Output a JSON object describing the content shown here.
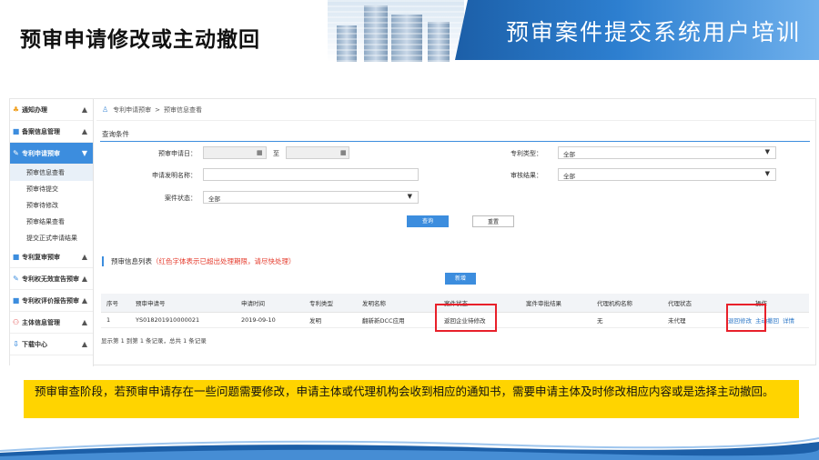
{
  "slide": {
    "title": "预审申请修改或主动撤回",
    "banner": "预审案件提交系统用户培训",
    "note": "预审审查阶段，若预审申请存在一些问题需要修改，申请主体或代理机构会收到相应的通知书，需要申请主体及时修改相应内容或是选择主动撤回。"
  },
  "colors": {
    "accent": "#3c8dde",
    "warning": "#e53b2c",
    "note_bg": "#ffd400",
    "highlight_box": "#e8202a"
  },
  "sidebar": {
    "groups": [
      {
        "icon": "bell-icon",
        "label": "通知办理",
        "chevron": "▲"
      },
      {
        "icon": "folder-icon",
        "label": "备案信息管理",
        "chevron": "▲"
      },
      {
        "icon": "edit-icon",
        "label": "专利申请预审",
        "chevron": "▼",
        "active": true,
        "items": [
          "预审信息查看",
          "预审待提交",
          "预审待修改",
          "预审结果查看",
          "提交正式申请结果"
        ]
      },
      {
        "icon": "folder-icon",
        "label": "专利复审预审",
        "chevron": "▲"
      },
      {
        "icon": "edit-icon",
        "label": "专利权无效宣告预审",
        "chevron": "▲"
      },
      {
        "icon": "folder-icon",
        "label": "专利权评价报告预审",
        "chevron": "▲"
      },
      {
        "icon": "person-icon",
        "label": "主体信息管理",
        "chevron": "▲"
      },
      {
        "icon": "download-icon",
        "label": "下载中心",
        "chevron": "▲"
      }
    ]
  },
  "breadcrumb": {
    "root": "专利申请预审",
    "separator": ">",
    "current": "预审信息查看"
  },
  "query": {
    "title": "查询条件",
    "apply_date_label": "预审申请日：",
    "to_label": "至",
    "patent_type_label": "专利类型：",
    "patent_type_value": "全部",
    "invention_name_label": "申请发明名称：",
    "review_result_label": "审核结果：",
    "review_result_value": "全部",
    "case_status_label": "案件状态：",
    "case_status_value": "全部",
    "search_button": "查询",
    "reset_button": "重置"
  },
  "list": {
    "title": "预审信息列表",
    "warning": "（红色字体表示已超出处理期限，请尽快处理）",
    "new_button": "新增",
    "columns": [
      "序号",
      "预审申请号",
      "申请时间",
      "专利类型",
      "发明名称",
      "案件状态",
      "案件审批结果",
      "代理机构名称",
      "代理状态",
      "操作"
    ],
    "rows": [
      {
        "no": "1",
        "app_no": "YS018201910000021",
        "date": "2019-09-10",
        "type": "发明",
        "name": "翻新新DCC应用",
        "status": "返回企业待修改",
        "result": "",
        "agency": "无",
        "agent_status": "未代理",
        "ops": [
          "退回修改",
          "主动撤回",
          "详情"
        ]
      }
    ],
    "pager": "显示第 1 到第 1 条记录，总共 1 条记录"
  }
}
